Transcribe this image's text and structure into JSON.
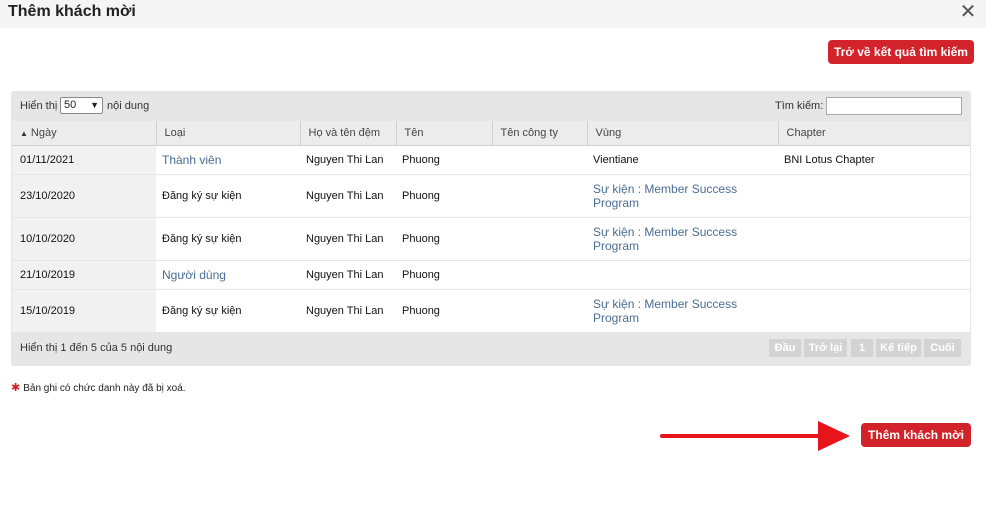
{
  "dialog": {
    "title": "Thêm khách mời"
  },
  "buttons": {
    "back": "Trở về kết quả tìm kiếm",
    "add_guest": "Thêm khách mời"
  },
  "table_controls": {
    "show_label": "Hiển thị",
    "page_length": "50",
    "content_label": "nội dung",
    "search_label": "Tìm kiếm:",
    "search_value": ""
  },
  "columns": [
    "Ngày",
    "Loại",
    "Họ và tên đệm",
    "Tên",
    "Tên công ty",
    "Vùng",
    "Chapter"
  ],
  "rows": [
    {
      "date": "01/11/2021",
      "type": "Thành viên",
      "middle": "Nguyen Thi Lan",
      "first": "Phuong",
      "company": "",
      "region": "Vientiane",
      "chapter": "BNI Lotus Chapter"
    },
    {
      "date": "23/10/2020",
      "type": "Đăng ký sự kiện",
      "middle": "Nguyen Thi Lan",
      "first": "Phuong",
      "company": "",
      "region": "Sự kiện : Member Success Program",
      "chapter": ""
    },
    {
      "date": "10/10/2020",
      "type": "Đăng ký sự kiện",
      "middle": "Nguyen Thi Lan",
      "first": "Phuong",
      "company": "",
      "region": "Sự kiện : Member Success Program",
      "chapter": ""
    },
    {
      "date": "21/10/2019",
      "type": "Người dùng",
      "middle": "Nguyen Thi Lan",
      "first": "Phuong",
      "company": "",
      "region": "",
      "chapter": ""
    },
    {
      "date": "15/10/2019",
      "type": "Đăng ký sự kiện",
      "middle": "Nguyen Thi Lan",
      "first": "Phuong",
      "company": "",
      "region": "Sự kiện : Member Success Program",
      "chapter": ""
    }
  ],
  "info": "Hiển thị 1 đến 5 của 5 nội dung",
  "pagination": {
    "first": "Đầu",
    "prev": "Trở lại",
    "page": "1",
    "next": "Kế tiếp",
    "last": "Cuối"
  },
  "note": "Bản ghi có chức danh này đã bị xoá.",
  "colors": {
    "accent": "#d2232a",
    "link": "#4a6d94",
    "arrow": "#e8141b"
  }
}
